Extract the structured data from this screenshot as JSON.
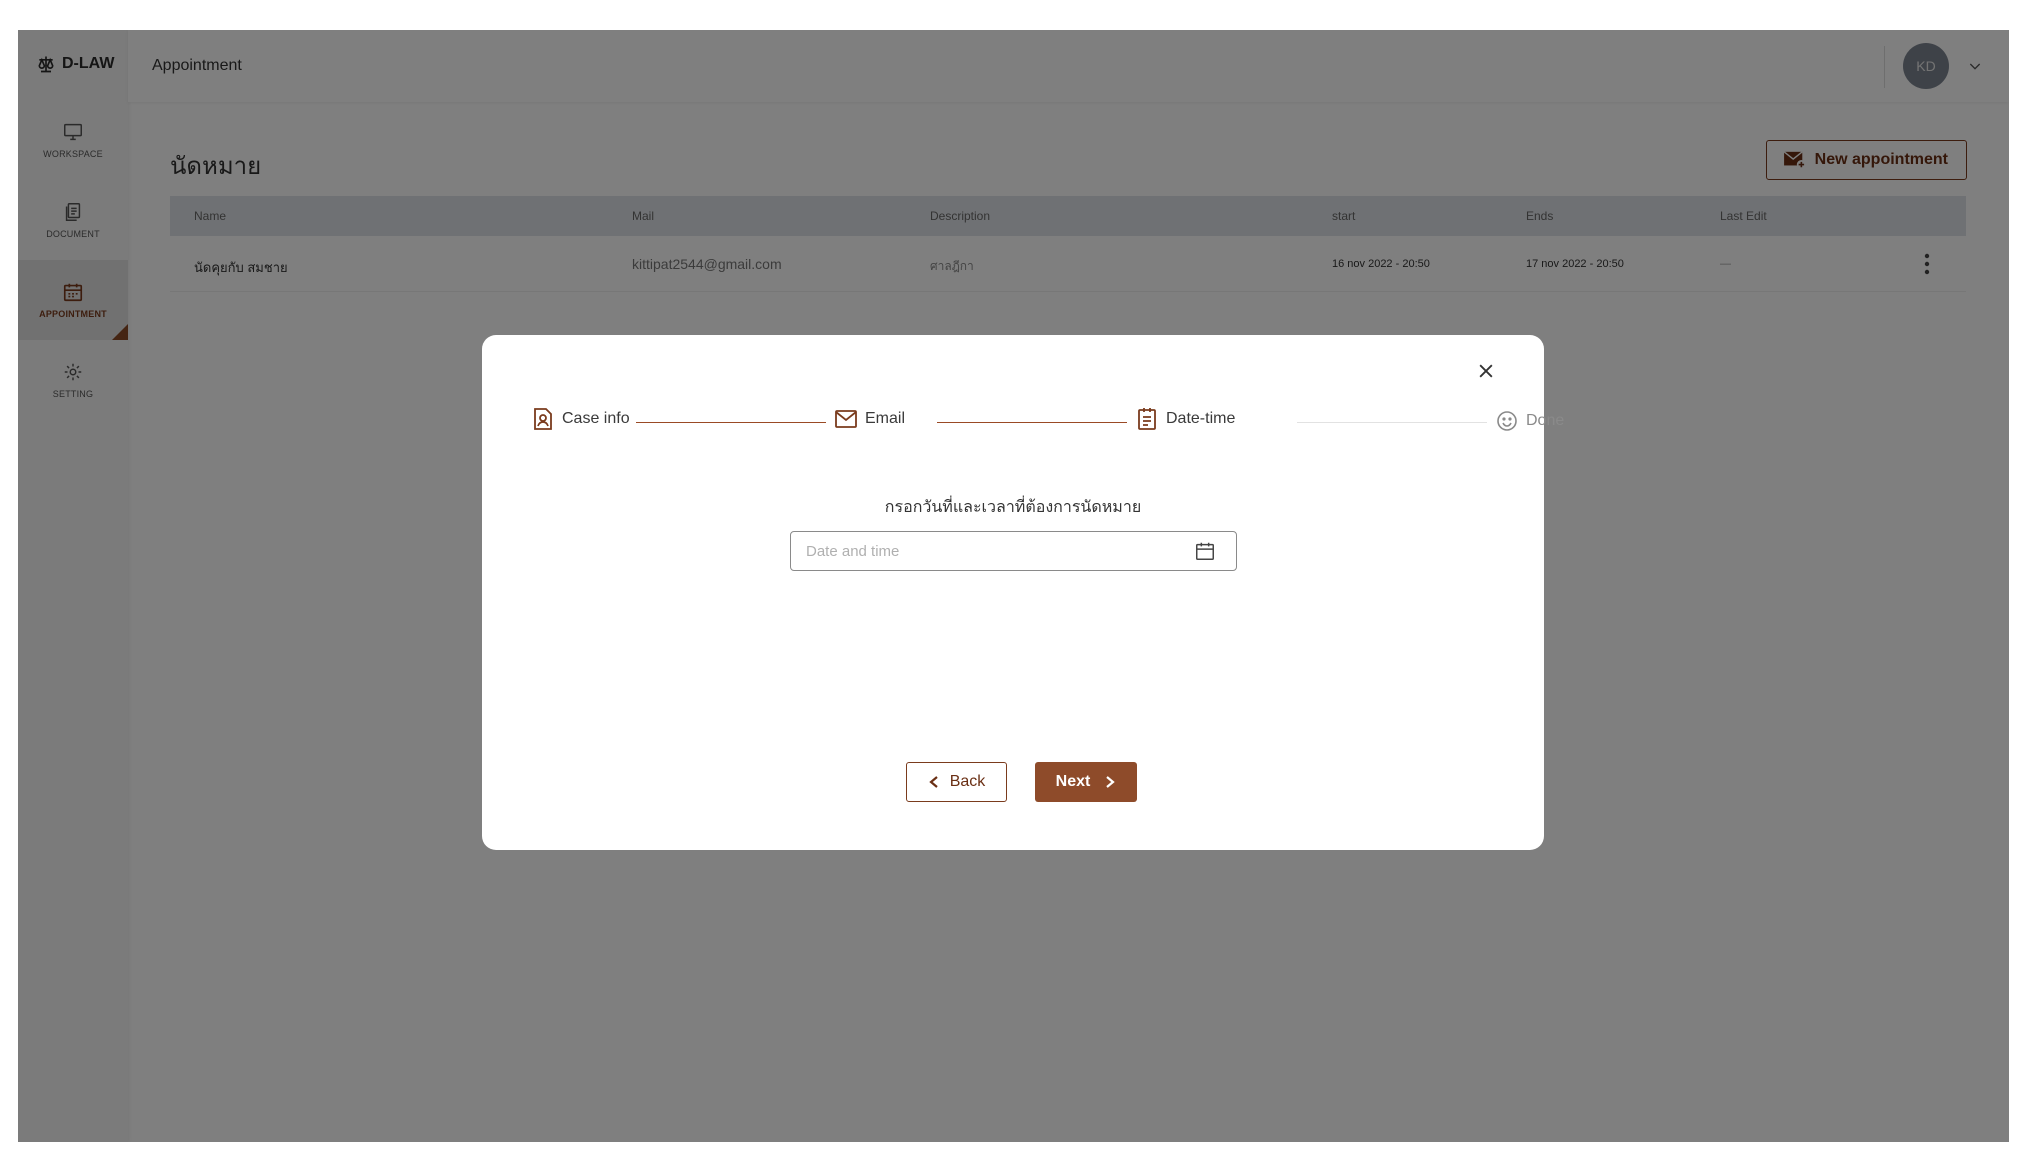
{
  "brand": {
    "name": "D-LAW",
    "icon": "scales-icon"
  },
  "sidebar": {
    "items": [
      {
        "label": "WORKSPACE",
        "icon": "monitor-icon",
        "active": false
      },
      {
        "label": "DOCUMENT",
        "icon": "document-icon",
        "active": false
      },
      {
        "label": "APPOINTMENT",
        "icon": "calendar-icon",
        "active": true
      },
      {
        "label": "SETTING",
        "icon": "gear-icon",
        "active": false
      }
    ]
  },
  "header": {
    "title": "Appointment",
    "avatar_initials": "KD"
  },
  "main": {
    "title": "นัดหมาย",
    "new_button_label": "New appointment",
    "table": {
      "columns": [
        "Name",
        "Mail",
        "Description",
        "start",
        "Ends",
        "Last Edit"
      ],
      "rows": [
        {
          "name": "นัดคุยกับ สมชาย",
          "mail": "kittipat2544@gmail.com",
          "description": "ศาลฎีกา",
          "start": "16 nov 2022 - 20:50",
          "ends": "17 nov 2022 - 20:50",
          "last_edit": "—"
        }
      ]
    }
  },
  "modal": {
    "steps": [
      {
        "label": "Case info",
        "icon": "contact-file-icon",
        "state": "done"
      },
      {
        "label": "Email",
        "icon": "mail-icon",
        "state": "done"
      },
      {
        "label": "Date-time",
        "icon": "clipboard-icon",
        "state": "current"
      },
      {
        "label": "Done",
        "icon": "smiley-icon",
        "state": "todo"
      }
    ],
    "prompt": "กรอกวันที่และเวลาที่ต้องการนัดหมาย",
    "datetime_input": {
      "placeholder": "Date and time",
      "value": ""
    },
    "back_label": "Back",
    "next_label": "Next"
  },
  "colors": {
    "accent": "#8e4b2a",
    "accent_dark": "#6a2f14",
    "overlay": "rgba(0,0,0,0.5)"
  }
}
